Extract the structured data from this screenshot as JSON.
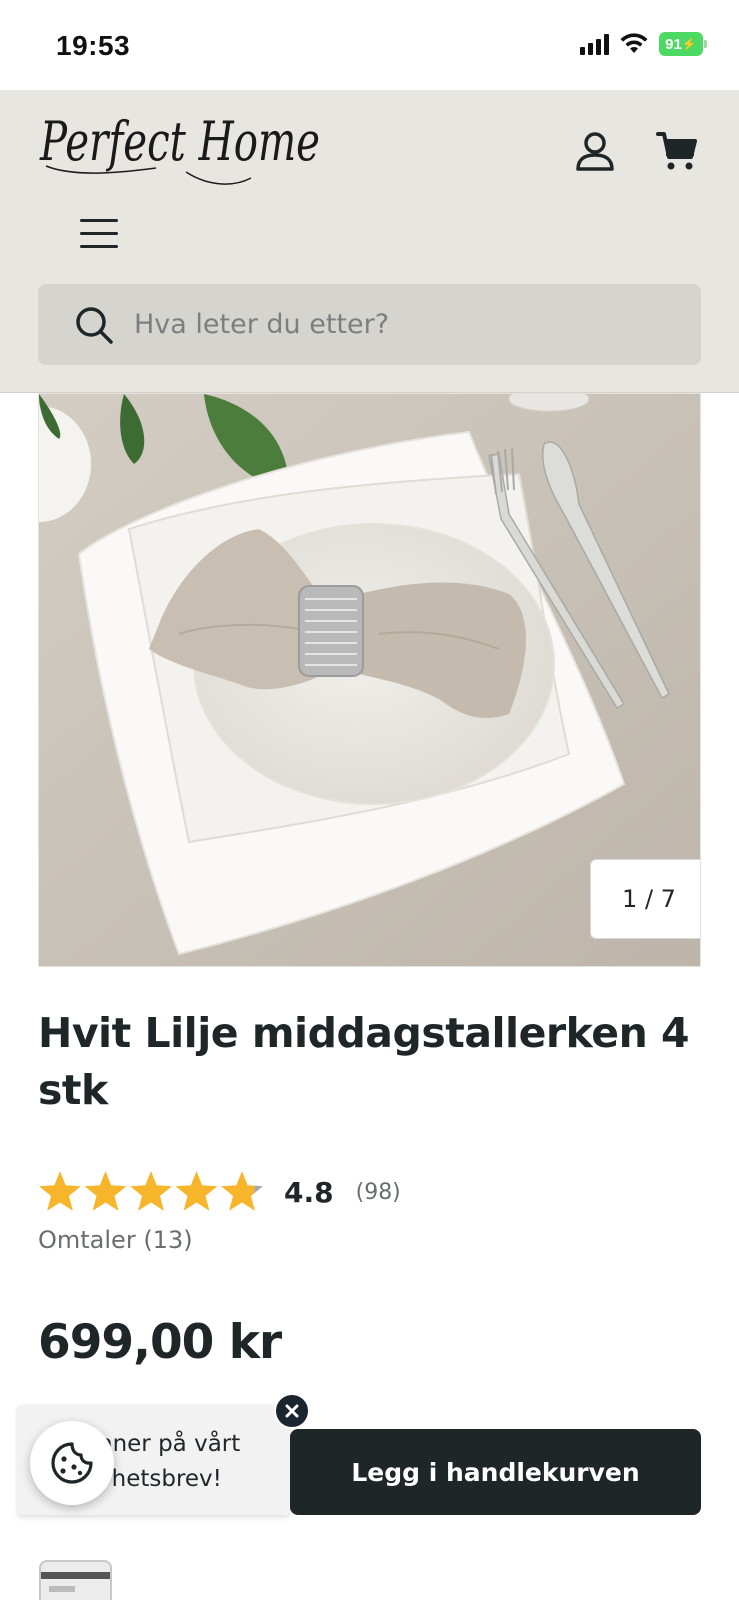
{
  "status_bar": {
    "time": "19:53",
    "battery": "91"
  },
  "header": {
    "logo_text": "Perfect Home",
    "search": {
      "placeholder": "Hva leter du etter?"
    }
  },
  "gallery": {
    "counter": "1 / 7"
  },
  "product": {
    "title": "Hvit Lilje middagstallerken 4 stk",
    "rating_value": "4.8",
    "rating_stars_fraction": 0.96,
    "rating_count": "(98)",
    "reviews_link": "Omtaler (13)",
    "price": "699,00 kr",
    "add_to_cart_label": "Legg i handlekurven"
  },
  "newsletter_popup": {
    "text": "nner på vårt\nyhetsbrev!"
  },
  "colors": {
    "header_bg": "#e8e6e1",
    "search_bg": "#d5d4cf",
    "button_dark": "#1f2628",
    "star_gold": "#f7b52c",
    "star_grey": "#a8a8a8",
    "battery_green": "#4cd964"
  },
  "icons": {
    "account": "user-icon",
    "cart": "cart-icon",
    "menu": "hamburger-icon",
    "search": "search-icon",
    "cookie": "cookie-icon",
    "close": "close-icon",
    "payment": "credit-card-icon"
  }
}
